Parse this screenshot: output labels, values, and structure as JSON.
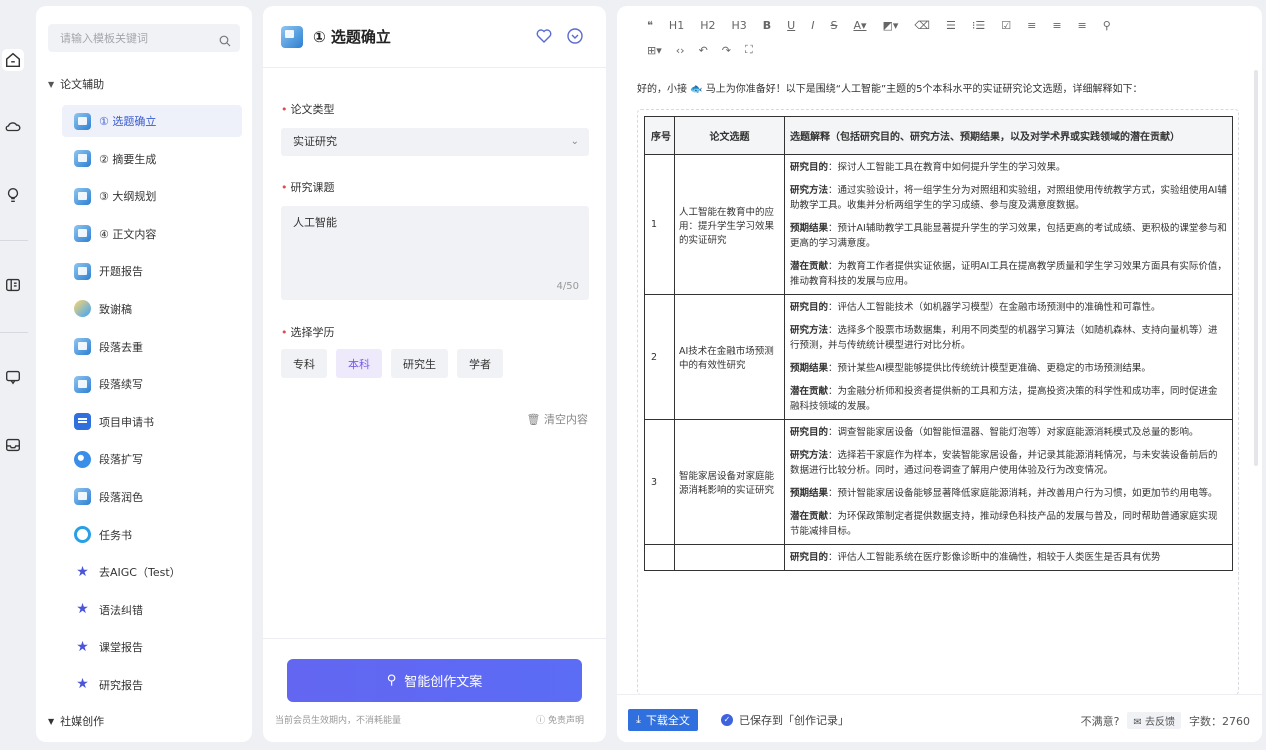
{
  "rail": {
    "icons": [
      "home-icon",
      "cloud-icon",
      "bulb-icon",
      "book-icon",
      "chat-icon",
      "inbox-icon"
    ]
  },
  "templates": {
    "search_placeholder": "请输入模板关键词",
    "group_label": "论文辅助",
    "items": [
      {
        "label": "① 选题确立",
        "icon": "doc"
      },
      {
        "label": "② 摘要生成",
        "icon": "doc"
      },
      {
        "label": "③ 大纲规划",
        "icon": "doc"
      },
      {
        "label": "④ 正文内容",
        "icon": "doc"
      },
      {
        "label": "开题报告",
        "icon": "doc"
      },
      {
        "label": "致谢稿",
        "icon": "bird"
      },
      {
        "label": "段落去重",
        "icon": "doc"
      },
      {
        "label": "段落续写",
        "icon": "doc"
      },
      {
        "label": "项目申请书",
        "icon": "square"
      },
      {
        "label": "段落扩写",
        "icon": "circ"
      },
      {
        "label": "段落润色",
        "icon": "doc"
      },
      {
        "label": "任务书",
        "icon": "ring"
      },
      {
        "label": "去AIGC（Test）",
        "icon": "star"
      },
      {
        "label": "语法纠错",
        "icon": "star"
      },
      {
        "label": "课堂报告",
        "icon": "star"
      },
      {
        "label": "研究报告",
        "icon": "star"
      }
    ],
    "next_group": "社媒创作"
  },
  "form": {
    "title": "① 选题确立",
    "paper_type_label": "论文类型",
    "paper_type_value": "实证研究",
    "topic_label": "研究课题",
    "topic_value": "人工智能",
    "topic_count": "4/50",
    "degree_label": "选择学历",
    "degrees": [
      "专科",
      "本科",
      "研究生",
      "学者"
    ],
    "clear_label": "清空内容",
    "generate_label": "智能创作文案",
    "note": "当前会员生效期内，不消耗能量",
    "disclaimer": "免责声明"
  },
  "editor": {
    "toolbar_row1": [
      "❝",
      "H1",
      "H2",
      "H3",
      "B",
      "U",
      "I",
      "S",
      "A▾",
      "◩▾",
      "⌫",
      "☰",
      "⁝☰",
      "☑",
      "≡",
      "≡",
      "≡",
      "⚲"
    ],
    "toolbar_row2": [
      "⊞▾",
      "‹›",
      "↶",
      "↷",
      "⛶"
    ],
    "intro": "好的，小接 🐟 马上为你准备好！以下是围绕“人工智能”主题的5个本科水平的实证研究论文选题，详细解释如下：",
    "headers": [
      "序号",
      "论文选题",
      "选题解释（包括研究目的、研究方法、预期结果，以及对学术界或实践领域的潜在贡献）"
    ],
    "rows": [
      {
        "no": "1",
        "topic": "人工智能在教育中的应用：提升学生学习效果的实证研究",
        "purpose_k": "研究目的",
        "purpose": "：探讨人工智能工具在教育中如何提升学生的学习效果。",
        "method_k": "研究方法",
        "method": "：通过实验设计，将一组学生分为对照组和实验组，对照组使用传统教学方式，实验组使用AI辅助教学工具。收集并分析两组学生的学习成绩、参与度及满意度数据。",
        "result_k": "预期结果",
        "result": "：预计AI辅助教学工具能显著提升学生的学习效果，包括更高的考试成绩、更积极的课堂参与和更高的学习满意度。",
        "contrib_k": "潜在贡献",
        "contrib": "：为教育工作者提供实证依据，证明AI工具在提高教学质量和学生学习效果方面具有实际价值，推动教育科技的发展与应用。"
      },
      {
        "no": "2",
        "topic": "AI技术在金融市场预测中的有效性研究",
        "purpose_k": "研究目的",
        "purpose": "：评估人工智能技术（如机器学习模型）在金融市场预测中的准确性和可靠性。",
        "method_k": "研究方法",
        "method": "：选择多个股票市场数据集，利用不同类型的机器学习算法（如随机森林、支持向量机等）进行预测，并与传统统计模型进行对比分析。",
        "result_k": "预期结果",
        "result": "：预计某些AI模型能够提供比传统统计模型更准确、更稳定的市场预测结果。",
        "contrib_k": "潜在贡献",
        "contrib": "：为金融分析师和投资者提供新的工具和方法，提高投资决策的科学性和成功率，同时促进金融科技领域的发展。"
      },
      {
        "no": "3",
        "topic": "智能家居设备对家庭能源消耗影响的实证研究",
        "purpose_k": "研究目的",
        "purpose": "：调查智能家居设备（如智能恒温器、智能灯泡等）对家庭能源消耗模式及总量的影响。",
        "method_k": "研究方法",
        "method": "：选择若干家庭作为样本，安装智能家居设备，并记录其能源消耗情况，与未安装设备前后的数据进行比较分析。同时，通过问卷调查了解用户使用体验及行为改变情况。",
        "result_k": "预期结果",
        "result": "：预计智能家居设备能够显著降低家庭能源消耗，并改善用户行为习惯，如更加节约用电等。",
        "contrib_k": "潜在贡献",
        "contrib": "：为环保政策制定者提供数据支持，推动绿色科技产品的发展与普及，同时帮助普通家庭实现节能减排目标。"
      },
      {
        "no": "",
        "topic": "",
        "purpose_k": "研究目的",
        "purpose": "：评估人工智能系统在医疗影像诊断中的准确性，相较于人类医生是否具有优势",
        "method_k": "",
        "method": "",
        "result_k": "",
        "result": "",
        "contrib_k": "",
        "contrib": ""
      }
    ],
    "download_label": "下载全文",
    "saved_label": "已保存到「创作记录」",
    "unsatisfied": "不满意?",
    "feedback": "去反馈",
    "word_count": "字数：2760"
  }
}
